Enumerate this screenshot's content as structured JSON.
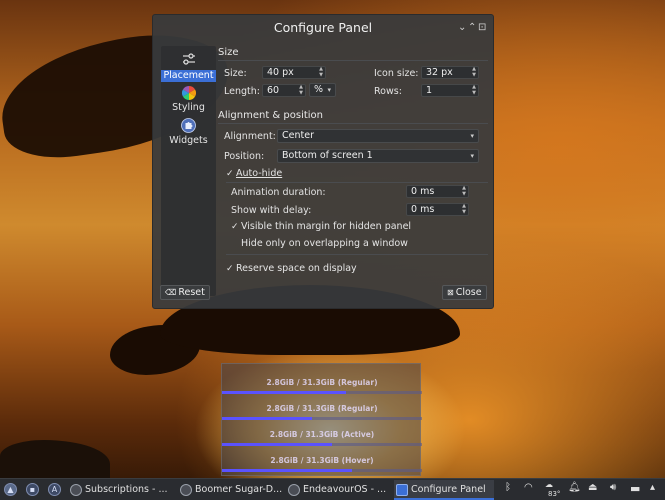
{
  "window": {
    "title": "Configure Panel",
    "minimize_glyph": "⌄",
    "maximize_glyph": "⌃",
    "close_glyph": "⊡"
  },
  "sidebar": {
    "items": [
      {
        "label": "Placement",
        "icon": "sliders-icon",
        "active": true
      },
      {
        "label": "Styling",
        "icon": "color-wheel-icon",
        "active": false
      },
      {
        "label": "Widgets",
        "icon": "puzzle-icon",
        "active": false
      }
    ]
  },
  "size": {
    "section_title": "Size",
    "size_label": "Size:",
    "size_value": "40 px",
    "icon_size_label": "Icon size:",
    "icon_size_value": "32 px",
    "length_label": "Length:",
    "length_value": "60",
    "length_unit": "%",
    "rows_label": "Rows:",
    "rows_value": "1"
  },
  "alignment": {
    "section_title": "Alignment & position",
    "alignment_label": "Alignment:",
    "alignment_value": "Center",
    "position_label": "Position:",
    "position_value": "Bottom of screen 1",
    "auto_hide_label": "Auto-hide",
    "auto_hide_checked": true,
    "animation_duration_label": "Animation duration:",
    "animation_duration_value": "0 ms",
    "show_delay_label": "Show with delay:",
    "show_delay_value": "0 ms",
    "thin_margin_label": "Visible thin margin for hidden panel",
    "thin_margin_checked": true,
    "hide_overlap_label": "Hide only on overlapping a window",
    "hide_overlap_checked": false,
    "reserve_space_label": "Reserve space on display",
    "reserve_space_checked": true
  },
  "buttons": {
    "reset_label": "Reset",
    "close_label": "Close"
  },
  "preview": {
    "rows": [
      {
        "text": "2.8GiB / 31.3GiB (Regular)",
        "fill": 0.62
      },
      {
        "text": "2.8GiB / 31.3GiB (Regular)",
        "fill": 0.45
      },
      {
        "text": "2.8GiB / 31.3GiB (Active)",
        "fill": 0.55
      },
      {
        "text": "2.8GiB / 31.3GiB (Hover)",
        "fill": 0.65
      }
    ]
  },
  "taskbar": {
    "tasks": [
      {
        "label": "Subscriptions - ...",
        "active": false
      },
      {
        "label": "Boomer Sugar-D...",
        "active": false
      },
      {
        "label": "EndeavourOS - ...",
        "active": false
      },
      {
        "label": "Configure Panel",
        "active": true
      }
    ],
    "weather_temp": "83°"
  }
}
